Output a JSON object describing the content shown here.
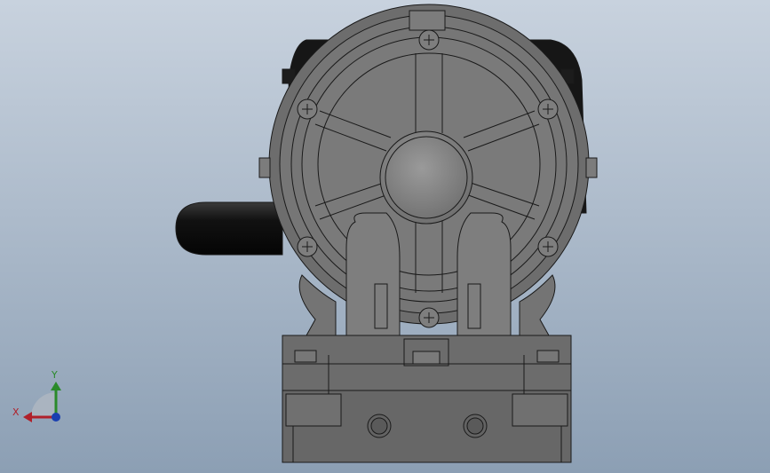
{
  "viewport": {
    "background_top": "#c8d2de",
    "background_bottom": "#8c9fb4"
  },
  "model": {
    "body_color": "#6f6f6f",
    "body_light": "#8a8a8a",
    "body_dark": "#4a4a4a",
    "edge_color": "#1a1a1a",
    "motor_cap_color": "#1e1e1e"
  },
  "triad": {
    "x_label": "X",
    "y_label": "Y",
    "x_color": "#b0202a",
    "y_color": "#2a8a2a",
    "z_color": "#1a3fb0"
  }
}
